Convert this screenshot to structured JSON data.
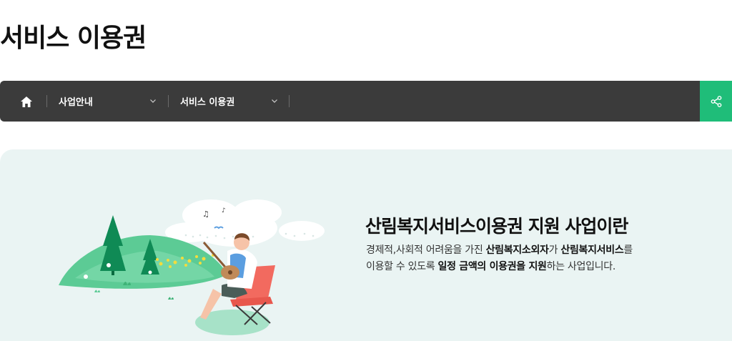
{
  "page": {
    "title": "서비스 이용권"
  },
  "nav": {
    "home_icon": "home-icon",
    "dropdown1": "사업안내",
    "dropdown2": "서비스 이용권",
    "share_icon": "share-icon",
    "share_color": "#1fbd79"
  },
  "banner": {
    "title": "산림복지서비스이용권 지원 사업이란",
    "desc": {
      "p1": "경제적,사회적 어려움을 가진 ",
      "b1": "산림복지소외자",
      "p2": "가 ",
      "b2": "산림복지서비스",
      "p3": "를",
      "p4": "이용할 수 있도록 ",
      "b3": "일정 금액의 이용권을 지원",
      "p5": "하는 사업입니다."
    },
    "background_color": "#eaf4f3"
  }
}
